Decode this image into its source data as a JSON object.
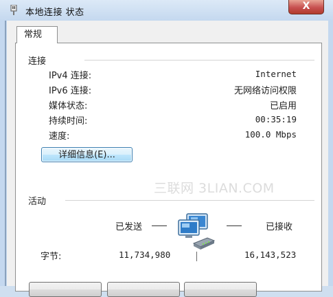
{
  "window": {
    "title": "本地连接 状态",
    "close_label": "X"
  },
  "tabs": [
    {
      "label": "常规"
    }
  ],
  "connection": {
    "heading": "连接",
    "rows": [
      {
        "label": "IPv4 连接:",
        "value": "Internet"
      },
      {
        "label": "IPv6 连接:",
        "value": "无网络访问权限"
      },
      {
        "label": "媒体状态:",
        "value": "已启用"
      },
      {
        "label": "持续时间:",
        "value": "00:35:19"
      },
      {
        "label": "速度:",
        "value": "100.0 Mbps"
      }
    ],
    "details_button": "详细信息(E)..."
  },
  "watermark": "三联网 3LIAN.COM",
  "activity": {
    "heading": "活动",
    "sent_label": "已发送",
    "received_label": "已接收",
    "bytes_label": "字节:",
    "bytes_sent": "11,734,980",
    "bytes_received": "16,143,523"
  },
  "icons": {
    "app": "network-adapter-icon",
    "activity": "network-computers-icon"
  }
}
